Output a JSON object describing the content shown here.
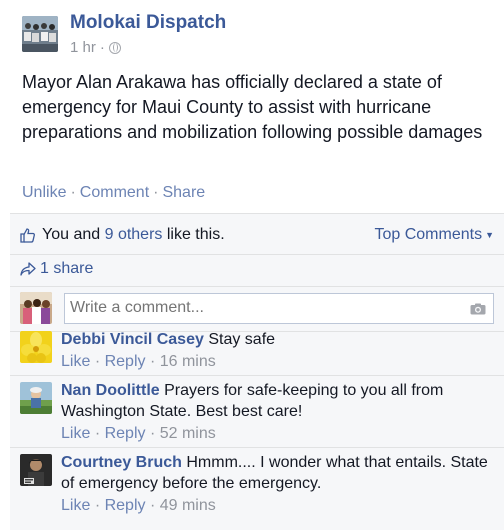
{
  "post": {
    "page_name": "Molokai Dispatch",
    "time": "1 hr",
    "meta_separator": "·",
    "privacy_icon": "globe-icon",
    "text": "Mayor Alan Arakawa has officially declared a state of emergency for Maui County to assist with hurricane preparations and mobilization following possible damages",
    "actions": {
      "unlike": "Unlike",
      "comment": "Comment",
      "share": "Share",
      "separator": "·"
    }
  },
  "ufi": {
    "like_icon": "thumbs-up-icon",
    "likes_prefix": "You and ",
    "likes_others": "9 others",
    "likes_suffix": " like this.",
    "top_comments": "Top Comments",
    "share_icon": "share-arrow-icon",
    "shares": "1 share",
    "composer": {
      "placeholder": "Write a comment...",
      "camera_icon": "camera-icon"
    }
  },
  "comments": [
    {
      "author": "Debbi Vincil Casey",
      "text": "Stay safe",
      "like": "Like",
      "reply": "Reply",
      "time": "16 mins"
    },
    {
      "author": "Nan Doolittle",
      "text": "Prayers for safe-keeping to you all from Washington State. Best best care!",
      "like": "Like",
      "reply": "Reply",
      "time": "52 mins"
    },
    {
      "author": "Courtney Bruch",
      "text": "Hmmm.... I wonder what that entails. State of emergency before the emergency.",
      "like": "Like",
      "reply": "Reply",
      "time": "49 mins"
    }
  ],
  "colors": {
    "link_blue": "#3b5998",
    "action_blue": "#6d84b4",
    "meta_gray": "#90949c",
    "ufi_background": "#f6f7f9"
  }
}
